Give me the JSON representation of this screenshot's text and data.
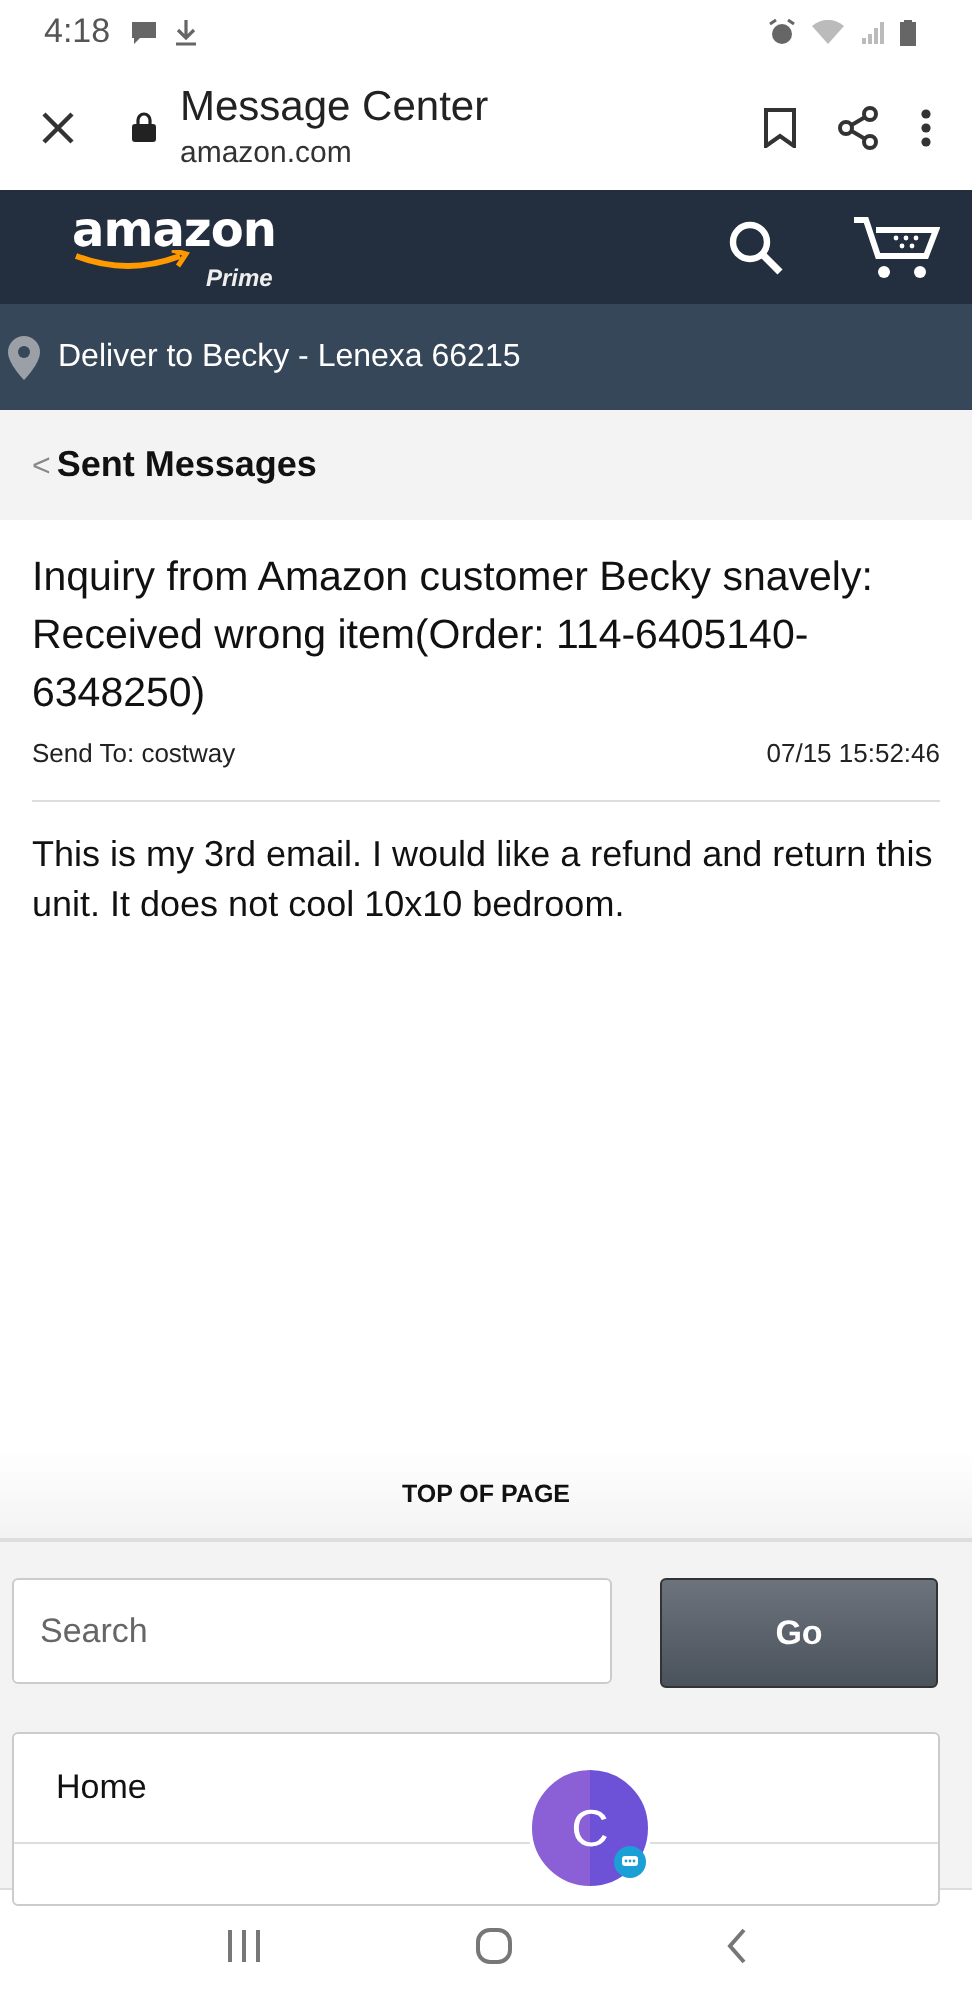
{
  "status_bar": {
    "time": "4:18"
  },
  "browser": {
    "title": "Message Center",
    "url": "amazon.com"
  },
  "header": {
    "logo": "amazon",
    "logo_sub": "Prime"
  },
  "delivery": {
    "text": "Deliver to Becky - Lenexa 66215"
  },
  "breadcrumb": {
    "back": "<",
    "label": "Sent Messages"
  },
  "message": {
    "subject": "Inquiry from Amazon customer Becky snavely: Received wrong item(Order: 114-6405140-6348250)",
    "send_to": "Send To: costway",
    "timestamp": "07/15 15:52:46",
    "body": "This is my 3rd email. I would like a refund and return this unit. It does not cool 10x10 bedroom."
  },
  "footer": {
    "top_link": "TOP OF PAGE",
    "search": {
      "placeholder": "Search"
    },
    "go_button": "Go",
    "menu": [
      "Home"
    ]
  },
  "chat_bubble": {
    "letter": "C"
  }
}
